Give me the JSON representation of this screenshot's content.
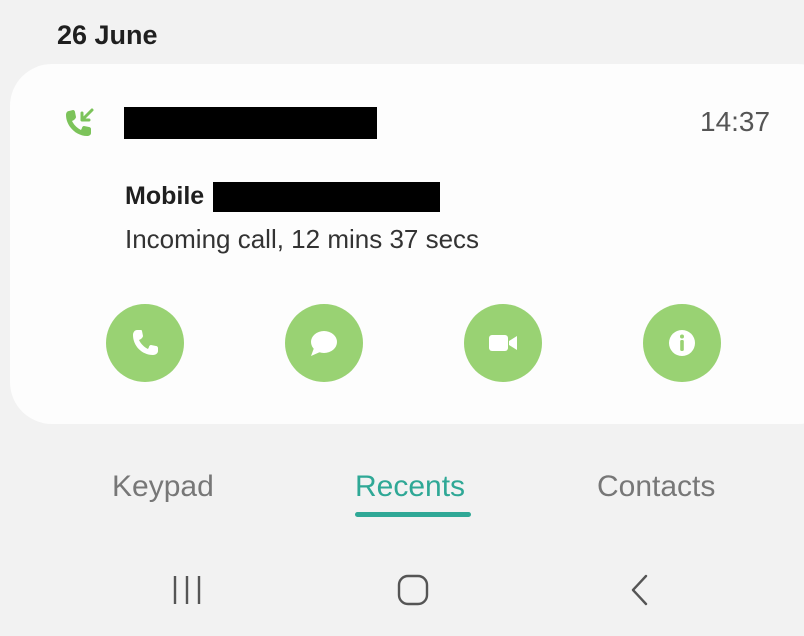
{
  "date_header": "26 June",
  "call_entry": {
    "time": "14:37",
    "number_type": "Mobile",
    "detail": "Incoming call, 12 mins 37 secs",
    "call_type_icon": "incoming-call-icon"
  },
  "actions": [
    {
      "name": "call",
      "icon": "phone-icon"
    },
    {
      "name": "message",
      "icon": "message-icon"
    },
    {
      "name": "video-call",
      "icon": "video-icon"
    },
    {
      "name": "details",
      "icon": "info-icon"
    }
  ],
  "tabs": [
    {
      "label": "Keypad",
      "active": false
    },
    {
      "label": "Recents",
      "active": true
    },
    {
      "label": "Contacts",
      "active": false
    }
  ],
  "nav_bar": [
    "recent-apps-icon",
    "home-icon",
    "back-icon"
  ],
  "colors": {
    "accent": "#2fa896",
    "action_green": "#99d273",
    "background": "#f2f2f2",
    "card": "#fdfdfd"
  }
}
